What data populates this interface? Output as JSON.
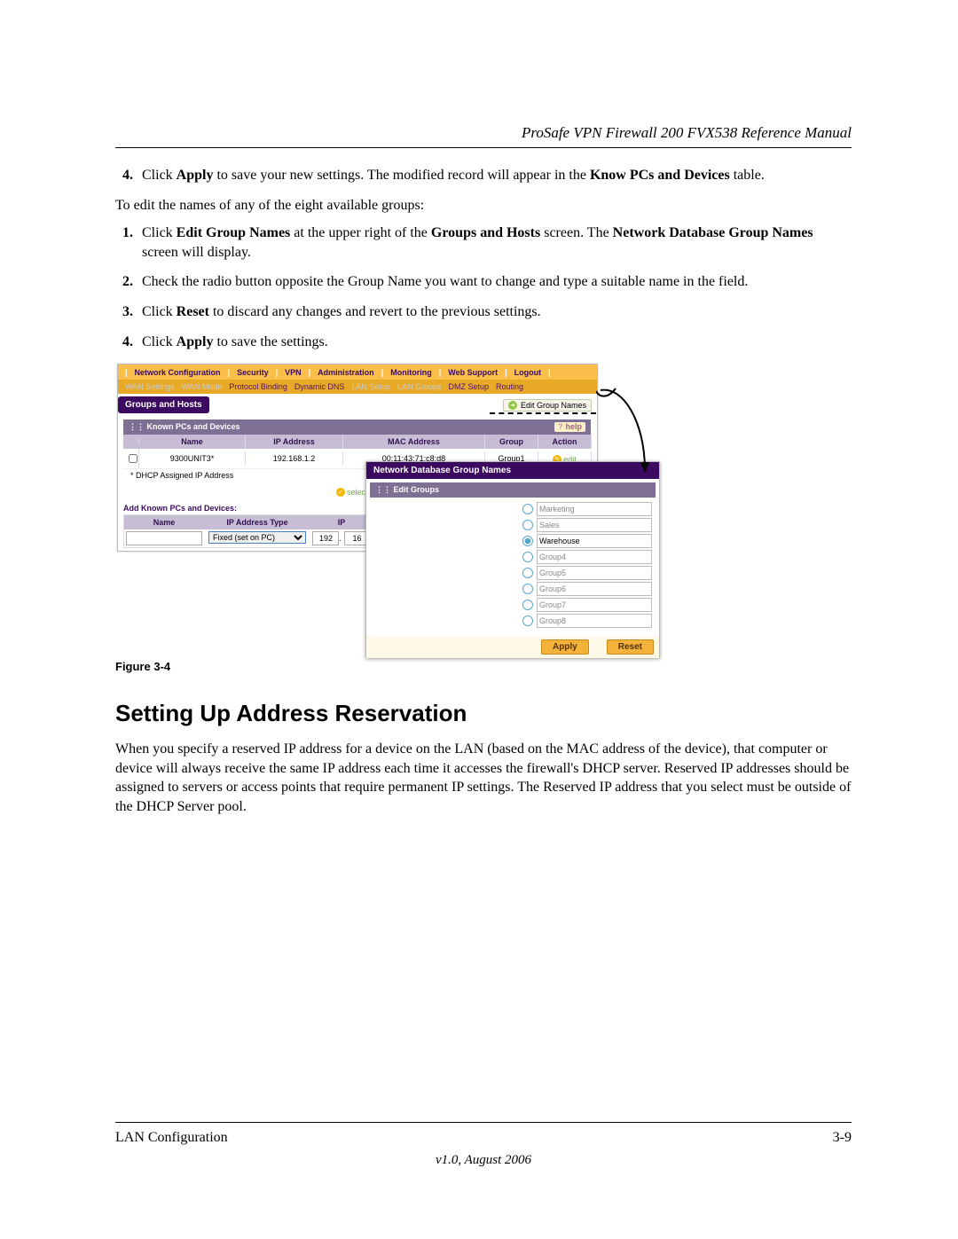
{
  "header_title": "ProSafe VPN Firewall 200 FVX538 Reference Manual",
  "step4_lead": "4.",
  "step4_text_a": "Click ",
  "step4_apply": "Apply",
  "step4_text_b": " to save your new settings. The modified record will appear in the ",
  "step4_know_pcs": "Know PCs and Devices",
  "step4_text_c": " table.",
  "intro2": "To edit the names of any of the eight available groups:",
  "s1_a": "Click ",
  "s1_b": "Edit Group Names",
  "s1_c": " at the upper right of the ",
  "s1_d": "Groups and Hosts",
  "s1_e": " screen. The ",
  "s1_f": "Network Database Group Names",
  "s1_g": " screen will display.",
  "s2": "Check the radio button opposite the Group Name you want to change and type a suitable name in the field.",
  "s3_a": "Click ",
  "s3_b": "Reset",
  "s3_c": " to discard any changes and revert to the previous settings.",
  "s4_a": "Click ",
  "s4_b": "Apply",
  "s4_c": " to save the settings.",
  "figure_caption": "Figure 3-4",
  "section_heading": "Setting Up Address Reservation",
  "section_para": "When you specify a reserved IP address for a device on the LAN (based on the MAC address of the device), that computer or device will always receive the same IP address each time it accesses the firewall's DHCP server. Reserved IP addresses should be assigned to servers or access points that require permanent IP settings. The Reserved IP address that you select must be outside of the DHCP Server pool.",
  "footer_left": "LAN Configuration",
  "footer_right": "3-9",
  "footer_version": "v1.0, August 2006",
  "nav": {
    "items": [
      "Network Configuration",
      "Security",
      "VPN",
      "Administration",
      "Monitoring",
      "Web Support",
      "Logout"
    ],
    "sub": [
      "WAN Settings",
      "WAN Mode",
      "Protocol Binding",
      "Dynamic DNS",
      "LAN Setup",
      "LAN Groups",
      "DMZ Setup",
      "Routing"
    ]
  },
  "panel": {
    "groups_hosts": "Groups and Hosts",
    "edit_group_names": "Edit Group Names",
    "known_pcs_hdr": "Known PCs and Devices",
    "help": "help",
    "cols": {
      "name": "Name",
      "ip": "IP Address",
      "mac": "MAC Address",
      "group": "Group",
      "action": "Action"
    },
    "row": {
      "name": "9300UNIT3*",
      "ip": "192.168.1.2",
      "mac": "00:11:43:71:c8:d8",
      "group": "Group1",
      "edit": "edit"
    },
    "footnote": "* DHCP Assigned IP Address",
    "select_all": "select all",
    "add_label": "Add Known PCs and Devices:",
    "add_cols": {
      "name": "Name",
      "iptype": "IP Address Type",
      "ip_head": "IP"
    },
    "iptype_value": "Fixed (set on PC)",
    "ip_part1": "192",
    "ip_part2": "16"
  },
  "popup": {
    "title": "Network Database Group Names",
    "edit_groups": "Edit Groups",
    "groups": [
      "Marketing",
      "Sales",
      "Warehouse",
      "Group4",
      "Group5",
      "Group6",
      "Group7",
      "Group8"
    ],
    "selected_index": 2,
    "apply": "Apply",
    "reset": "Reset"
  }
}
